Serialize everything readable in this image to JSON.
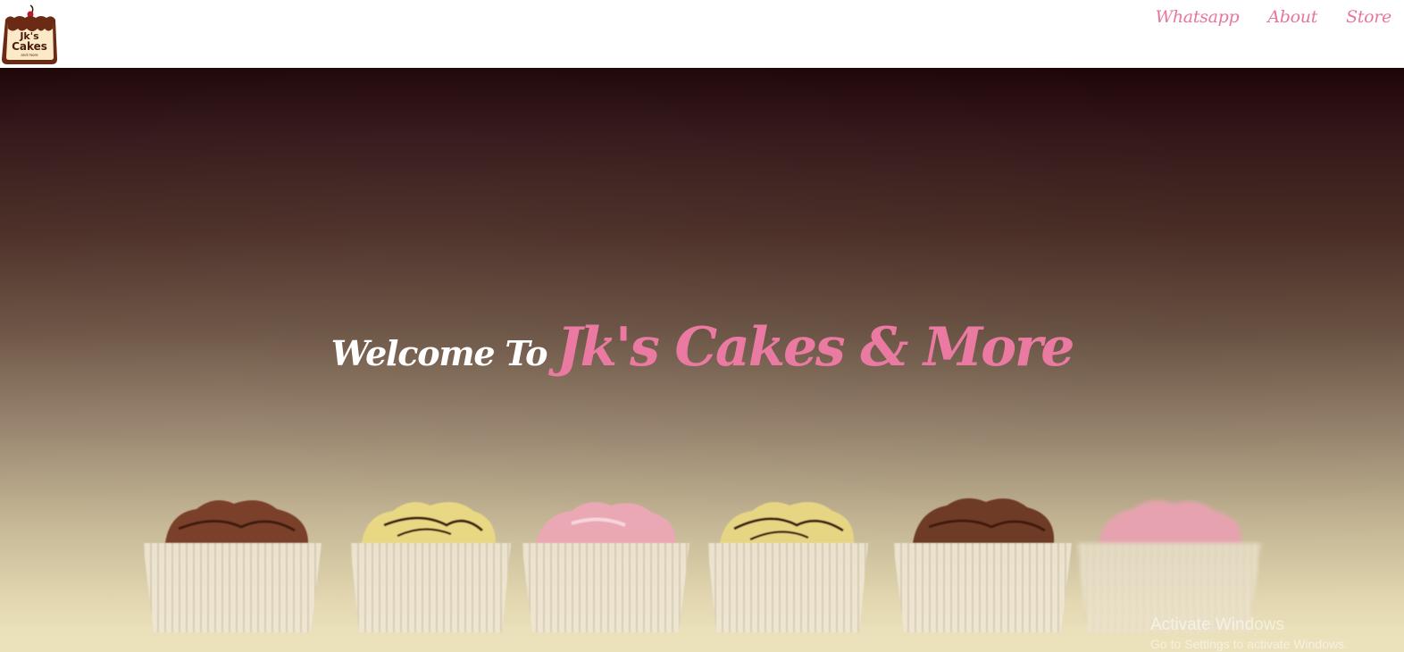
{
  "header": {
    "logo": {
      "line1": "Jk's",
      "line2": "Cakes",
      "line3": "and more"
    },
    "nav": [
      {
        "label": "Whatsapp"
      },
      {
        "label": "About"
      },
      {
        "label": "Store"
      }
    ]
  },
  "hero": {
    "welcome": "Welcome To",
    "brand": "Jk's Cakes & More",
    "cupcake_flavors": [
      "chocolate",
      "lemon",
      "strawberry",
      "lemon",
      "chocolate",
      "strawberry"
    ]
  },
  "watermark": {
    "title": "Activate Windows",
    "subtitle": "Go to Settings to activate Windows."
  },
  "colors": {
    "accent": "#ea7aa1",
    "nav": "#e8769a",
    "logo_brown": "#6b2a14",
    "logo_cream": "#fbe9c8"
  }
}
